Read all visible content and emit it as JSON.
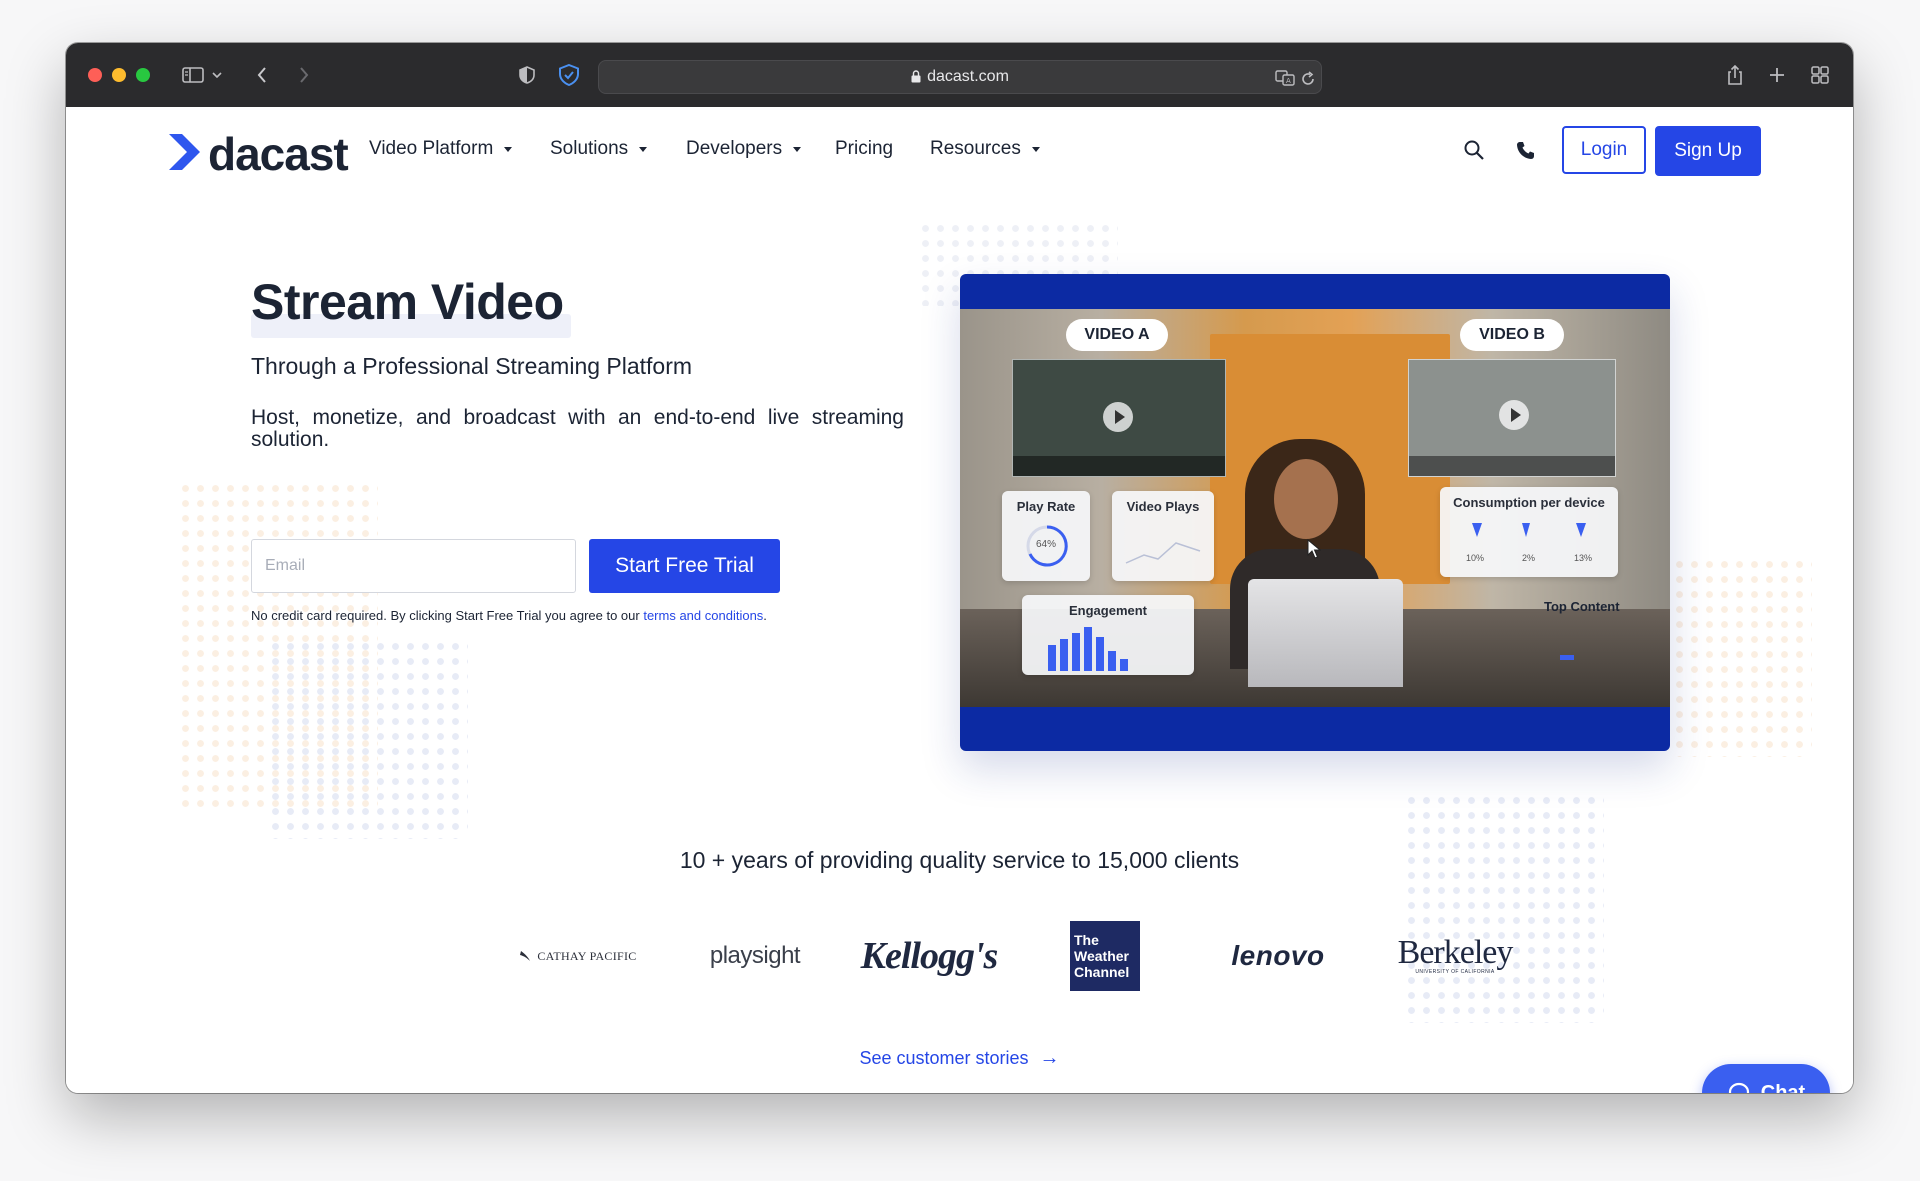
{
  "browser": {
    "url": "dacast.com"
  },
  "nav": {
    "brand": "dacast",
    "items": [
      {
        "label": "Video Platform"
      },
      {
        "label": "Solutions"
      },
      {
        "label": "Developers"
      },
      {
        "label": "Pricing"
      },
      {
        "label": "Resources"
      }
    ],
    "login_label": "Login",
    "signup_label": "Sign Up"
  },
  "hero": {
    "title": "Stream Video",
    "subtitle": "Through a Professional Streaming Platform",
    "description": "Host, monetize, and broadcast with an end-to-end live streaming solution.",
    "email_placeholder": "Email",
    "email_value": "",
    "cta_label": "Start Free Trial",
    "disclaimer": "No credit card required. By clicking Start Free Trial you agree to our ",
    "terms_link": "terms and conditions",
    "disclaimer_end": "."
  },
  "video_mockup": {
    "tag_a": "VIDEO A",
    "tag_b": "VIDEO B",
    "play_rate_label": "Play Rate",
    "play_rate_value": "64%",
    "video_plays_label": "Video Plays",
    "engagement_label": "Engagement",
    "consumption_label": "Consumption per device",
    "consumption_values": [
      "10%",
      "2%",
      "13%"
    ],
    "top_content_label": "Top Content"
  },
  "clients": {
    "headline": "10 + years of providing quality service to 15,000 clients",
    "logos": [
      {
        "name": "CATHAY PACIFIC"
      },
      {
        "name": "playsight"
      },
      {
        "name": "Kellogg's"
      },
      {
        "name": "The Weather Channel",
        "lines": [
          "The",
          "Weather",
          "Channel"
        ]
      },
      {
        "name": "lenovo"
      },
      {
        "name": "Berkeley",
        "sub": "UNIVERSITY OF CALIFORNIA"
      }
    ],
    "stories_label": "See customer stories",
    "stories_arrow": "→"
  },
  "chat": {
    "label": "Chat"
  },
  "colors": {
    "brand_blue": "#2546e6",
    "dark_text": "#1c2434",
    "video_frame": "#0c2aa3",
    "chat": "#3a5ff0"
  }
}
